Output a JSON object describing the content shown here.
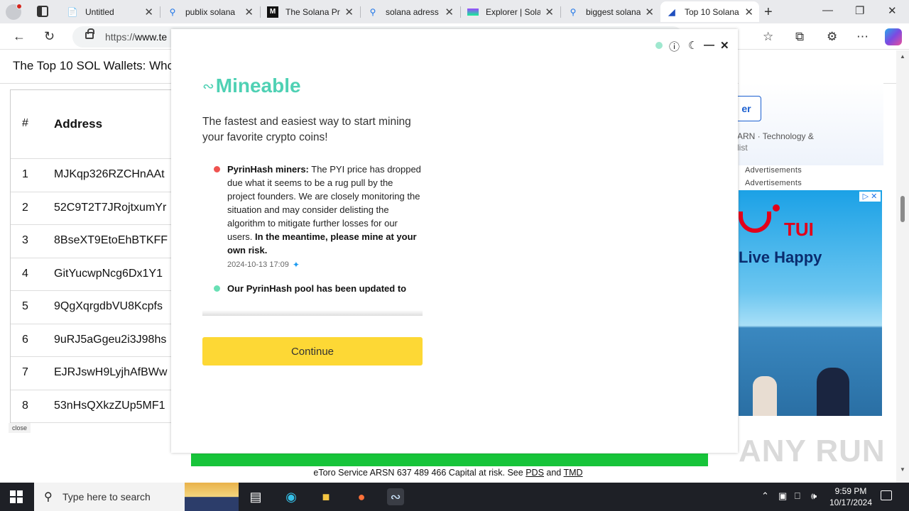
{
  "browser": {
    "tabs": [
      {
        "title": "Untitled",
        "favicon": "page-icon",
        "active": false
      },
      {
        "title": "publix solana",
        "favicon": "search-icon",
        "active": false
      },
      {
        "title": "The Solana Pr",
        "favicon": "medium-icon",
        "active": false
      },
      {
        "title": "solana adress",
        "favicon": "search-icon",
        "active": false
      },
      {
        "title": "Explorer | Sola",
        "favicon": "solana-icon",
        "active": false
      },
      {
        "title": "biggest solana",
        "favicon": "search-icon",
        "active": false
      },
      {
        "title": "Top 10 Solana",
        "favicon": "site-icon",
        "active": true
      }
    ],
    "url_prefix": "https://",
    "url_host": "www.te"
  },
  "page": {
    "title": "The Top 10 SOL Wallets: Who",
    "table": {
      "headers": [
        "#",
        "Address"
      ],
      "rows": [
        {
          "n": "1",
          "address": "MJKqp326RZCHnAAt"
        },
        {
          "n": "2",
          "address": "52C9T2T7JRojtxumYr"
        },
        {
          "n": "3",
          "address": "8BseXT9EtoEhBTKFF"
        },
        {
          "n": "4",
          "address": "GitYucwpNcg6Dx1Y1"
        },
        {
          "n": "5",
          "address": "9QgXqrgdbVU8Kcpfs"
        },
        {
          "n": "6",
          "address": "9uRJ5aGgeu2i3J98hs"
        },
        {
          "n": "7",
          "address": "EJRJswH9LyjhAfBWw"
        },
        {
          "n": "8",
          "address": "53nHsQXkzZUp5MF1"
        }
      ]
    },
    "close_chip": "close",
    "right_ad": {
      "button": "er",
      "line1": "ARN · Technology &",
      "line2": "list"
    },
    "advertisements": [
      "Advertisements",
      "Advertisements"
    ],
    "tui_ad": {
      "brand": "TUI",
      "slogan": "Live Happy"
    },
    "footer": {
      "text": "eToro Service ARSN 637 489 466 Capital at risk. See",
      "link1": "PDS",
      "and": "and",
      "link2": "TMD"
    },
    "watermark": "ANY RUN"
  },
  "modal": {
    "logo": "Mineable",
    "tagline": "The fastest and easiest way to start mining your favorite crypto coins!",
    "news": [
      {
        "color": "#ef5350",
        "bold": "PyrinHash miners:",
        "text": " The PYI price has dropped due what it seems to be a rug pull by the project founders. We are closely monitoring the situation and may consider delisting the algorithm to mitigate further losses for our users.",
        "bold_tail": " In the meantime, please mine at your own risk.",
        "date": "2024-10-13 17:09"
      },
      {
        "color": "#69e0b5",
        "bold": "Our PyrinHash pool has been updated to",
        "text": "",
        "bold_tail": "",
        "date": ""
      }
    ],
    "continue_label": "Continue"
  },
  "taskbar": {
    "search_placeholder": "Type here to search",
    "time": "9:59 PM",
    "date": "10/17/2024"
  }
}
